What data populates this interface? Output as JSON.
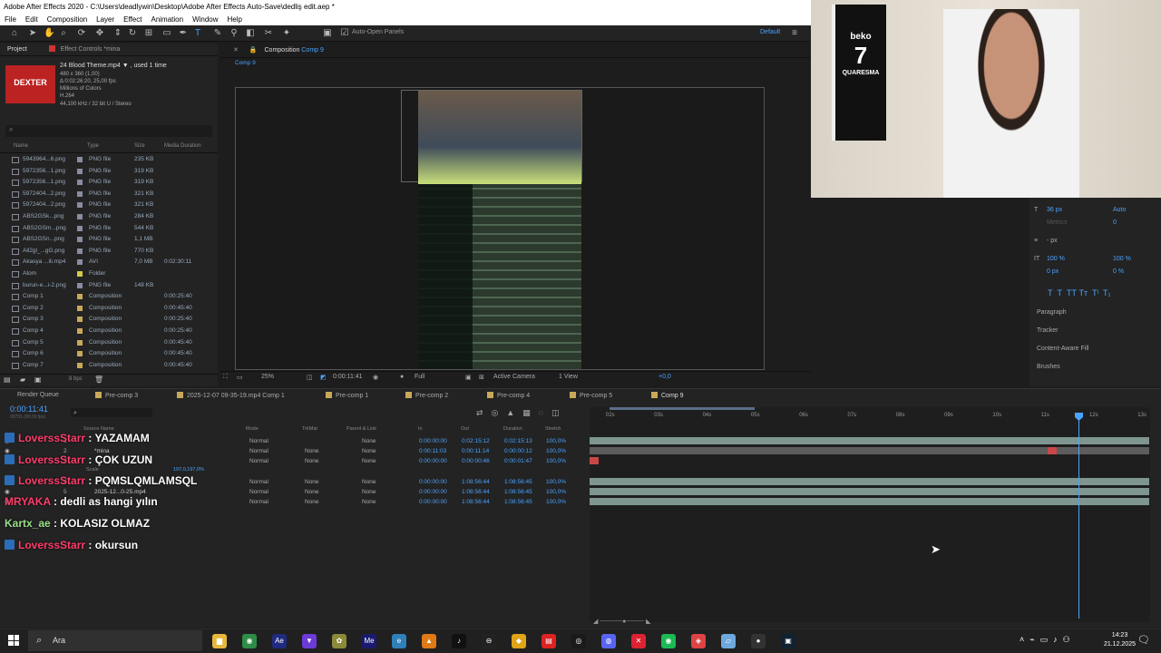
{
  "app": {
    "title": "Adobe After Effects 2020 - C:\\Users\\deadlywin\\Desktop\\Adobe After Effects Auto-Save\\dedliş edit.aep *",
    "menu": [
      "File",
      "Edit",
      "Composition",
      "Layer",
      "Effect",
      "Animation",
      "Window",
      "Help"
    ],
    "toolbar": {
      "auto_open": "Auto-Open Panels",
      "workspace": "Default"
    }
  },
  "project": {
    "tab": "Project",
    "effect_tab": "Effect Controls *mina",
    "thumb_label": "DEXTER",
    "asset_name": "24 Blood Theme.mp4 ▼ , used 1 time",
    "asset_meta": [
      "480 x 360 (1,00)",
      "Δ 0:02:26:20, 25,00 fps",
      "Millions of Colors",
      "H.264",
      "44,100 kHz / 32 bit U / Stereo"
    ],
    "columns": [
      "Name",
      "Type",
      "Size",
      "Media Duration"
    ],
    "files": [
      {
        "name": "5943964...6.png",
        "type": "PNG file",
        "size": "235 KB",
        "dur": "",
        "color": "#8a8aa0"
      },
      {
        "name": "5972356...1.png",
        "type": "PNG file",
        "size": "319 KB",
        "dur": "",
        "color": "#8a8aa0"
      },
      {
        "name": "5972356...1.png",
        "type": "PNG file",
        "size": "319 KB",
        "dur": "",
        "color": "#8a8aa0"
      },
      {
        "name": "5972404...2.png",
        "type": "PNG file",
        "size": "321 KB",
        "dur": "",
        "color": "#8a8aa0"
      },
      {
        "name": "5972404...2.png",
        "type": "PNG file",
        "size": "321 KB",
        "dur": "",
        "color": "#8a8aa0"
      },
      {
        "name": "ABS2GSk...png",
        "type": "PNG file",
        "size": "284 KB",
        "dur": "",
        "color": "#8a8aa0"
      },
      {
        "name": "ABS2GSm...png",
        "type": "PNG file",
        "size": "544 KB",
        "dur": "",
        "color": "#8a8aa0"
      },
      {
        "name": "ABS2GSn...png",
        "type": "PNG file",
        "size": "1,1 MB",
        "dur": "",
        "color": "#8a8aa0"
      },
      {
        "name": "All2gl_...gG.png",
        "type": "PNG file",
        "size": "770 KB",
        "dur": "",
        "color": "#8a8aa0"
      },
      {
        "name": "Akasya ...ili.mp4",
        "type": "AVI",
        "size": "7,0 MB",
        "dur": "0:02:30:11",
        "color": "#8a8aa0"
      },
      {
        "name": "Atom",
        "type": "Folder",
        "size": "",
        "dur": "",
        "color": "#d6c84a"
      },
      {
        "name": "burun-e...i-2.png",
        "type": "PNG file",
        "size": "148 KB",
        "dur": "",
        "color": "#8a8aa0"
      },
      {
        "name": "Comp 1",
        "type": "Composition",
        "size": "",
        "dur": "0:00:25:40",
        "color": "#c9a85a"
      },
      {
        "name": "Comp 2",
        "type": "Composition",
        "size": "",
        "dur": "0:00:45:40",
        "color": "#c9a85a"
      },
      {
        "name": "Comp 3",
        "type": "Composition",
        "size": "",
        "dur": "0:00:25:40",
        "color": "#c9a85a"
      },
      {
        "name": "Comp 4",
        "type": "Composition",
        "size": "",
        "dur": "0:00:25:40",
        "color": "#c9a85a"
      },
      {
        "name": "Comp 5",
        "type": "Composition",
        "size": "",
        "dur": "0:00:45:40",
        "color": "#c9a85a"
      },
      {
        "name": "Comp 6",
        "type": "Composition",
        "size": "",
        "dur": "0:00:45:40",
        "color": "#c9a85a"
      },
      {
        "name": "Comp 7",
        "type": "Composition",
        "size": "",
        "dur": "0:00:45:40",
        "color": "#c9a85a"
      }
    ],
    "bpc": "8 bpc"
  },
  "composition": {
    "tab": "Composition",
    "comp_name": "Comp 9",
    "sub_tab": "Comp 9",
    "zoom": "25%",
    "time": "0:00:11:41",
    "quality": "Full",
    "camera": "Active Camera",
    "view": "1 View",
    "exposure": "+0,0"
  },
  "right_panel": {
    "font_size": "36 px",
    "leading": "Auto",
    "metrics": "Metrics",
    "tracking": "0",
    "stroke": "- px",
    "vscale": "100 %",
    "hscale": "100 %",
    "baseline": "0 px",
    "tsume": "0 %",
    "paragraph": "Paragraph",
    "tracker": "Tracker",
    "caf": "Content-Aware Fill",
    "brushes": "Brushes"
  },
  "timeline": {
    "tabs": [
      {
        "label": "Render Queue",
        "color": ""
      },
      {
        "label": "Pre-comp 3",
        "color": "#c9a85a"
      },
      {
        "label": "2025-12-07 09-35-19.mp4 Comp 1",
        "color": "#c9a85a"
      },
      {
        "label": "Pre-comp 1",
        "color": "#c9a85a"
      },
      {
        "label": "Pre-comp 2",
        "color": "#c9a85a"
      },
      {
        "label": "Pre-comp 4",
        "color": "#c9a85a"
      },
      {
        "label": "Pre-comp 5",
        "color": "#c9a85a"
      },
      {
        "label": "Comp 9",
        "color": "#c9a85a"
      }
    ],
    "current_time": "0:00:11:41",
    "frames": "00701 (60.00 fps)",
    "ruler": [
      "02s",
      "03s",
      "04s",
      "05s",
      "06s",
      "07s",
      "08s",
      "09s",
      "10s",
      "11s",
      "12s",
      "13s"
    ],
    "headers": {
      "source": "Source Name",
      "mode": "Mode",
      "trkmat": "TrkMat",
      "parent": "Parent & Link",
      "in": "In",
      "out": "Out",
      "duration": "Duration",
      "stretch": "Stretch"
    },
    "layers": [
      {
        "num": "1",
        "name": "",
        "mode": "Normal",
        "trk": "",
        "parent": "None",
        "in": "0:00:00:00",
        "out": "0:02:15:12",
        "dur": "0:02:15:13",
        "stretch": "100,0%"
      },
      {
        "num": "2",
        "name": "*mina",
        "mode": "Normal",
        "trk": "None",
        "parent": "None",
        "in": "0:00:11:03",
        "out": "0:00:11:14",
        "dur": "0:00:00:12",
        "stretch": "100,0%"
      },
      {
        "num": "3",
        "name": "",
        "mode": "Normal",
        "trk": "None",
        "parent": "None",
        "in": "0:00:00:00",
        "out": "0:00:00:46",
        "dur": "0:00:01:47",
        "stretch": "100,0%"
      },
      {
        "num": "4",
        "name": "",
        "mode": "Normal",
        "trk": "None",
        "parent": "None",
        "in": "0:00:00:00",
        "out": "1:08:56:44",
        "dur": "1:08:56:45",
        "stretch": "100,0%"
      },
      {
        "num": "5",
        "name": "2025-12...0-25.mp4",
        "mode": "Normal",
        "trk": "None",
        "parent": "None",
        "in": "0:00:00:00",
        "out": "1:08:56:44",
        "dur": "1:08:56:45",
        "stretch": "100,0%"
      },
      {
        "num": "6",
        "name": "",
        "mode": "Normal",
        "trk": "None",
        "parent": "None",
        "in": "0:00:00:00",
        "out": "1:08:56:44",
        "dur": "1:08:56:45",
        "stretch": "100,0%"
      }
    ],
    "scale_label": "Scale",
    "scale_value": "197,0,197,0%"
  },
  "chat": [
    {
      "user": "LoverssStarr",
      "msg": "YAZAMAM",
      "twitch": true,
      "color": "#ff3d6b"
    },
    {
      "user": "LoverssStarr",
      "msg": "ÇOK UZUN",
      "twitch": true,
      "color": "#ff3d6b"
    },
    {
      "user": "LoverssStarr",
      "msg": "PQMSLQMLAMSQL",
      "twitch": true,
      "color": "#ff3d6b"
    },
    {
      "user": "MRYAKA",
      "msg": "dedli as hangi yılın",
      "twitch": false,
      "color": "#ff3d6b"
    },
    {
      "user": "Kartx_ae",
      "msg": "KOLASIZ OLMAZ",
      "twitch": false,
      "color": "#9be08a"
    },
    {
      "user": "LoverssStarr",
      "msg": "okursun",
      "twitch": true,
      "color": "#ff3d6b"
    }
  ],
  "webcam": {
    "shirt_brand": "beko",
    "shirt_number": "7",
    "shirt_name": "QUARESMA"
  },
  "taskbar": {
    "search_placeholder": "Ara",
    "time": "14:23",
    "date": "21.12.2025",
    "icons": [
      "explorer-icon",
      "chrome-icon",
      "after-effects-icon",
      "proton-vpn-icon",
      "app-icon",
      "media-encoder-icon",
      "edge-icon",
      "vlc-icon",
      "tiktok-icon",
      "discord-icon",
      "maps-icon",
      "pdf-icon",
      "steelseries-icon",
      "discord-icon",
      "x-icon",
      "spotify-icon",
      "app-icon",
      "notes-icon",
      "obs-icon",
      "console-icon"
    ]
  }
}
